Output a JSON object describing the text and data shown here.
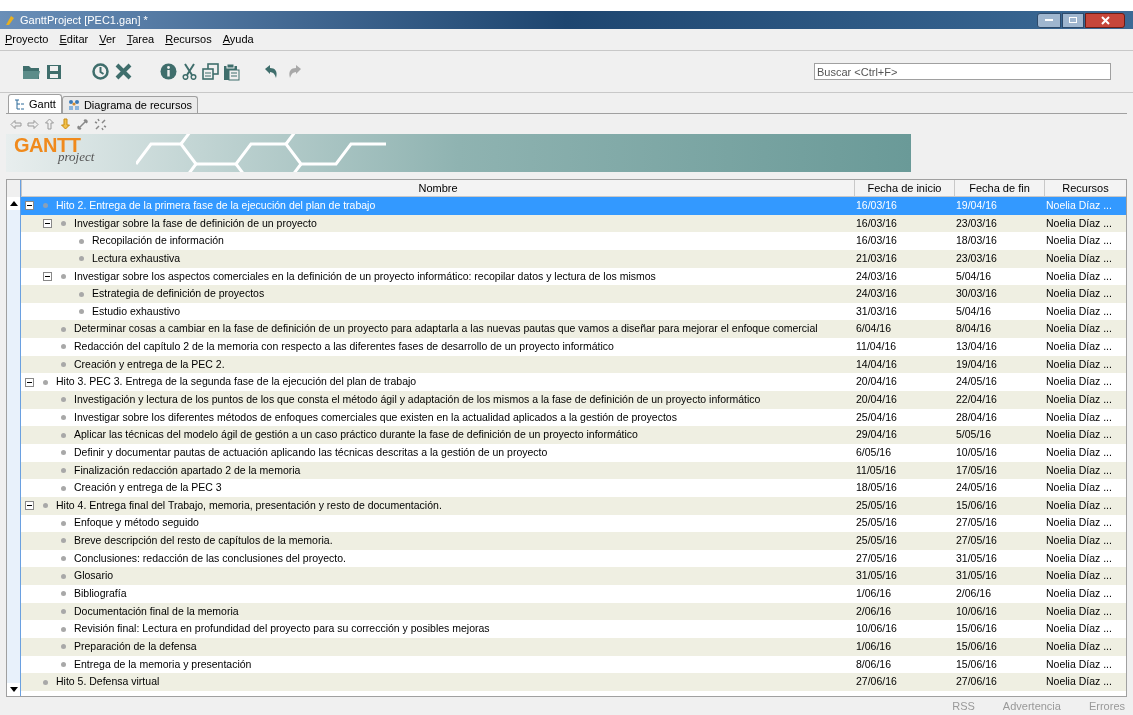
{
  "window": {
    "title": "GanttProject [PEC1.gan] *"
  },
  "menu": [
    "Proyecto",
    "Editar",
    "Ver",
    "Tarea",
    "Recursos",
    "Ayuda"
  ],
  "search": {
    "placeholder": "Buscar <Ctrl+F>"
  },
  "tabs": [
    {
      "label": "Gantt",
      "selected": true
    },
    {
      "label": "Diagrama de recursos",
      "selected": false
    }
  ],
  "logo": {
    "word": "GANTT",
    "subword": "project"
  },
  "table": {
    "columns": [
      "Nombre",
      "Fecha de inicio",
      "Fecha de fin",
      "Recursos"
    ],
    "rows": [
      {
        "name": "Hito 2. Entrega de la primera fase de la ejecución del plan de trabajo",
        "start": "16/03/16",
        "end": "19/04/16",
        "resources": "Noelia Díaz ...",
        "selected": true,
        "expanded": true,
        "children": [
          {
            "name": "Investigar sobre la fase de definición de un proyecto",
            "start": "16/03/16",
            "end": "23/03/16",
            "resources": "Noelia Díaz ...",
            "selected": false,
            "expanded": true,
            "children": [
              {
                "name": "Recopilación de información",
                "start": "16/03/16",
                "end": "18/03/16",
                "resources": "Noelia Díaz ...",
                "selected": false
              },
              {
                "name": "Lectura exhaustiva",
                "start": "21/03/16",
                "end": "23/03/16",
                "resources": "Noelia Díaz ...",
                "selected": false
              }
            ]
          },
          {
            "name": "Investigar sobre los aspectos comerciales en la definición de un proyecto informático: recopilar datos y lectura de los mismos",
            "start": "24/03/16",
            "end": "5/04/16",
            "resources": "Noelia Díaz ...",
            "selected": false,
            "expanded": true,
            "children": [
              {
                "name": "Estrategia de definición de proyectos",
                "start": "24/03/16",
                "end": "30/03/16",
                "resources": "Noelia Díaz ...",
                "selected": false
              },
              {
                "name": "Estudio exhaustivo",
                "start": "31/03/16",
                "end": "5/04/16",
                "resources": "Noelia Díaz ...",
                "selected": false
              }
            ]
          },
          {
            "name": "Determinar cosas a cambiar en la fase de definición de un proyecto para adaptarla a las nuevas pautas que vamos a diseñar para mejorar el enfoque comercial",
            "start": "6/04/16",
            "end": "8/04/16",
            "resources": "Noelia Díaz ...",
            "selected": false
          },
          {
            "name": "Redacción del capítulo 2 de la memoria con respecto a las diferentes fases de desarrollo de un proyecto informático",
            "start": "11/04/16",
            "end": "13/04/16",
            "resources": "Noelia Díaz ...",
            "selected": false
          },
          {
            "name": "Creación y entrega de la PEC 2.",
            "start": "14/04/16",
            "end": "19/04/16",
            "resources": "Noelia Díaz ...",
            "selected": false
          }
        ]
      },
      {
        "name": "Hito 3. PEC 3. Entrega de la segunda fase de la ejecución del plan de trabajo",
        "start": "20/04/16",
        "end": "24/05/16",
        "resources": "Noelia Díaz ...",
        "selected": false,
        "expanded": true,
        "children": [
          {
            "name": "Investigación y lectura de los puntos de los que consta el método ágil y adaptación de los mismos a la fase de definición de un proyecto informático",
            "start": "20/04/16",
            "end": "22/04/16",
            "resources": "Noelia Díaz ...",
            "selected": false
          },
          {
            "name": "Investigar sobre los diferentes métodos de enfoques comerciales que existen en la actualidad aplicados a la gestión de proyectos",
            "start": "25/04/16",
            "end": "28/04/16",
            "resources": "Noelia Díaz ...",
            "selected": false
          },
          {
            "name": "Aplicar las técnicas del modelo ágil de gestión a un caso práctico durante la fase de definición de un proyecto informático",
            "start": "29/04/16",
            "end": "5/05/16",
            "resources": "Noelia Díaz ...",
            "selected": false
          },
          {
            "name": "Definir y documentar pautas de actuación aplicando las técnicas descritas a la gestión de un proyecto",
            "start": "6/05/16",
            "end": "10/05/16",
            "resources": "Noelia Díaz ...",
            "selected": false
          },
          {
            "name": "Finalización redacción apartado 2 de la memoria",
            "start": "11/05/16",
            "end": "17/05/16",
            "resources": "Noelia Díaz ...",
            "selected": false
          },
          {
            "name": "Creación y entrega de la PEC 3",
            "start": "18/05/16",
            "end": "24/05/16",
            "resources": "Noelia Díaz ...",
            "selected": false
          }
        ]
      },
      {
        "name": "Hito 4. Entrega final del Trabajo, memoria, presentación y resto de documentación.",
        "start": "25/05/16",
        "end": "15/06/16",
        "resources": "Noelia Díaz ...",
        "selected": false,
        "expanded": true,
        "children": [
          {
            "name": "Enfoque y método seguido",
            "start": "25/05/16",
            "end": "27/05/16",
            "resources": "Noelia Díaz ...",
            "selected": false
          },
          {
            "name": "Breve descripción del resto de capítulos de la memoria.",
            "start": "25/05/16",
            "end": "27/05/16",
            "resources": "Noelia Díaz ...",
            "selected": false
          },
          {
            "name": "Conclusiones: redacción de las conclusiones del proyecto.",
            "start": "27/05/16",
            "end": "31/05/16",
            "resources": "Noelia Díaz ...",
            "selected": false
          },
          {
            "name": "Glosario",
            "start": "31/05/16",
            "end": "31/05/16",
            "resources": "Noelia Díaz ...",
            "selected": false
          },
          {
            "name": "Bibliografía",
            "start": "1/06/16",
            "end": "2/06/16",
            "resources": "Noelia Díaz ...",
            "selected": false
          },
          {
            "name": "Documentación final de la memoria",
            "start": "2/06/16",
            "end": "10/06/16",
            "resources": "Noelia Díaz ...",
            "selected": false
          },
          {
            "name": "Revisión final: Lectura en profundidad del proyecto para su corrección y posibles mejoras",
            "start": "10/06/16",
            "end": "15/06/16",
            "resources": "Noelia Díaz ...",
            "selected": false
          },
          {
            "name": "Preparación de la defensa",
            "start": "1/06/16",
            "end": "15/06/16",
            "resources": "Noelia Díaz ...",
            "selected": false
          },
          {
            "name": "Entrega de la memoria y presentación",
            "start": "8/06/16",
            "end": "15/06/16",
            "resources": "Noelia Díaz ...",
            "selected": false
          }
        ]
      },
      {
        "name": "Hito 5. Defensa virtual",
        "start": "27/06/16",
        "end": "27/06/16",
        "resources": "Noelia Díaz ...",
        "selected": false
      }
    ]
  },
  "status_bar": [
    "RSS",
    "Advertencia",
    "Errores"
  ]
}
